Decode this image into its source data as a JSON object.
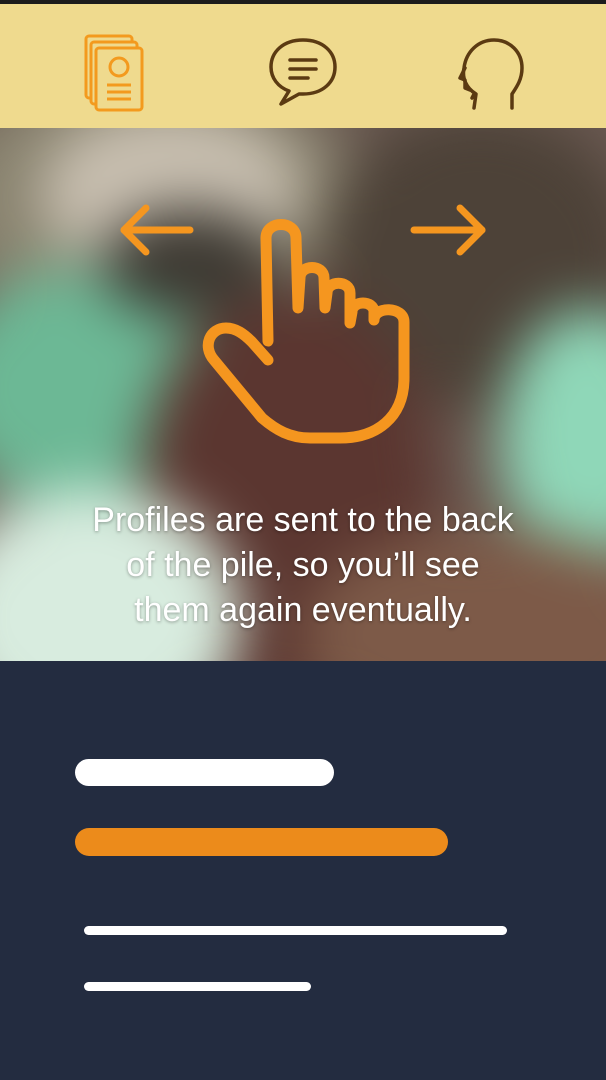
{
  "tabs": [
    {
      "icon": "profile-cards-icon",
      "active": true
    },
    {
      "icon": "chat-bubble-icon",
      "active": false
    },
    {
      "icon": "head-profile-icon",
      "active": false
    }
  ],
  "hero": {
    "gesture_icon": "swipe-hand-icon",
    "left_arrow_icon": "arrow-left-icon",
    "right_arrow_icon": "arrow-right-icon",
    "message_lines": [
      "Profiles are sent to the back",
      "of the pile, so you’ll see",
      "them again eventually."
    ]
  },
  "colors": {
    "tabbar_bg": "#efda8e",
    "accent": "#f39a1e",
    "icon_inactive": "#5b3a12",
    "panel_bg": "#232c40",
    "placeholder_white": "#ffffff",
    "placeholder_orange": "#ec8b1b"
  }
}
